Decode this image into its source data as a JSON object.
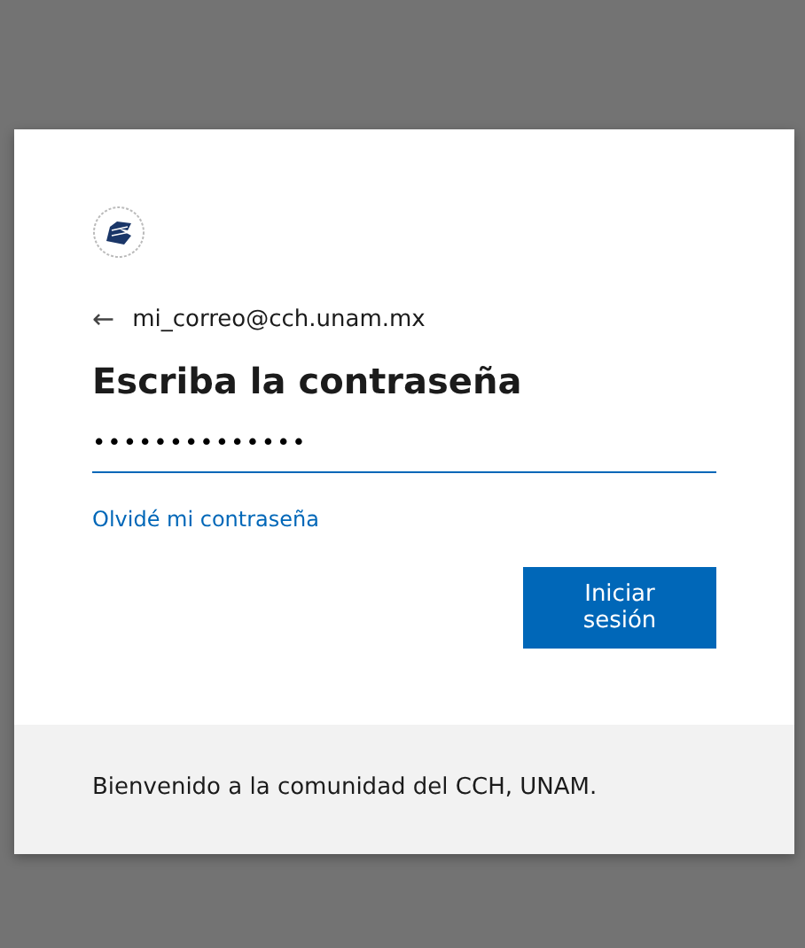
{
  "identity": {
    "back": "←",
    "email": "mi_correo@cch.unam.mx"
  },
  "title": "Escriba la contraseña",
  "password": {
    "value": "••••••••••••••"
  },
  "forgot_link": "Olvidé mi contraseña",
  "buttons": [
    "Iniciar sesión"
  ],
  "footer": "Bienvenido a la comunidad del CCH, UNAM."
}
